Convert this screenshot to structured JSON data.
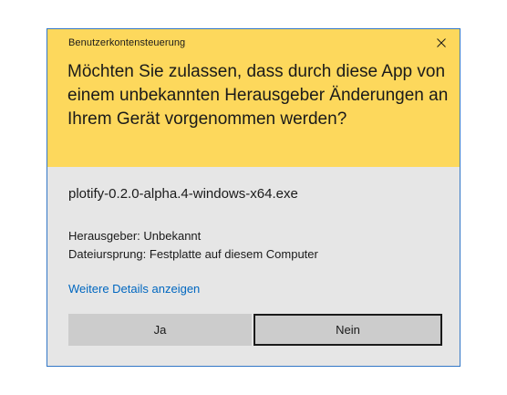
{
  "dialog": {
    "caption": "Benutzerkontensteuerung",
    "question": "Möchten Sie zulassen, dass durch diese App von einem unbekannten Herausgeber Änderungen an Ihrem Gerät vorgenommen werden?",
    "app_name": "plotify-0.2.0-alpha.4-windows-x64.exe",
    "publisher": "Herausgeber: Unbekannt",
    "file_origin": "Dateiursprung: Festplatte auf diesem Computer",
    "details_link": "Weitere Details anzeigen",
    "yes_label": "Ja",
    "no_label": "Nein",
    "close_icon": "close-icon"
  },
  "colors": {
    "header_background": "#fdd85c",
    "body_background": "#e6e6e6",
    "border": "#3277c7",
    "link": "#0067c0",
    "button": "#cccccc"
  }
}
